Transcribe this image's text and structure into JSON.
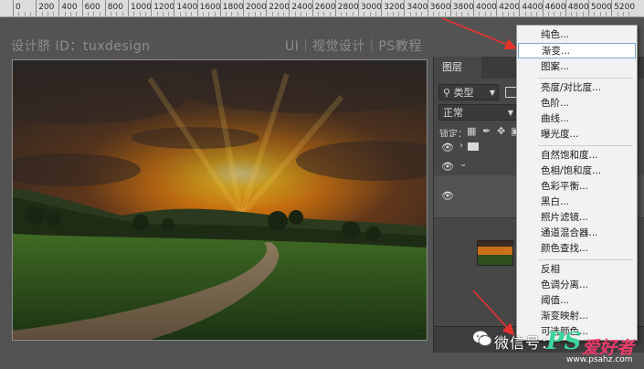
{
  "ruler": {
    "ticks": [
      "0",
      "200",
      "400",
      "600",
      "800",
      "1000",
      "1200",
      "1400",
      "1600",
      "1800",
      "2000",
      "2200",
      "2400",
      "2600",
      "2800",
      "3000",
      "3200",
      "3400",
      "3600",
      "3800",
      "4000",
      "4200",
      "4400",
      "4600",
      "4800",
      "5000",
      "5200"
    ]
  },
  "watermark": {
    "left": "设计脐 ID：tuxdesign",
    "right": "UI｜视觉设计｜PS教程"
  },
  "layers_panel": {
    "tab": "图层",
    "filter_label": "类型",
    "blend_mode": "正常",
    "lock_label": "锁定："
  },
  "menu": {
    "items": [
      {
        "label": "纯色...",
        "highlighted": false
      },
      {
        "label": "渐变...",
        "highlighted": true
      },
      {
        "label": "图案...",
        "highlighted": false
      },
      {
        "label": "亮度/对比度...",
        "highlighted": false
      },
      {
        "label": "色阶...",
        "highlighted": false
      },
      {
        "label": "曲线...",
        "highlighted": false
      },
      {
        "label": "曝光度...",
        "highlighted": false
      },
      {
        "label": "自然饱和度...",
        "highlighted": false
      },
      {
        "label": "色相/饱和度...",
        "highlighted": false
      },
      {
        "label": "色彩平衡...",
        "highlighted": false
      },
      {
        "label": "黑白...",
        "highlighted": false
      },
      {
        "label": "照片滤镜...",
        "highlighted": false
      },
      {
        "label": "通道混合器...",
        "highlighted": false
      },
      {
        "label": "颜色查找...",
        "highlighted": false
      },
      {
        "label": "反相",
        "highlighted": false
      },
      {
        "label": "色调分离...",
        "highlighted": false
      },
      {
        "label": "阈值...",
        "highlighted": false
      },
      {
        "label": "渐变映射...",
        "highlighted": false
      },
      {
        "label": "可选颜色...",
        "highlighted": false
      }
    ]
  },
  "footer_watermark": {
    "wechat": "微信号：",
    "ps_logo": "PS",
    "ps_cn": "爱好者",
    "url": "www.psahz.com"
  },
  "colors": {
    "workspace": "#535353",
    "panel": "#474747",
    "menu_bg": "#f2f2f2",
    "menu_highlight_border": "#78a7d6",
    "arrow": "#e8322c",
    "ps_green": "#3cd69b",
    "ps_pink": "#ec3a6b"
  }
}
